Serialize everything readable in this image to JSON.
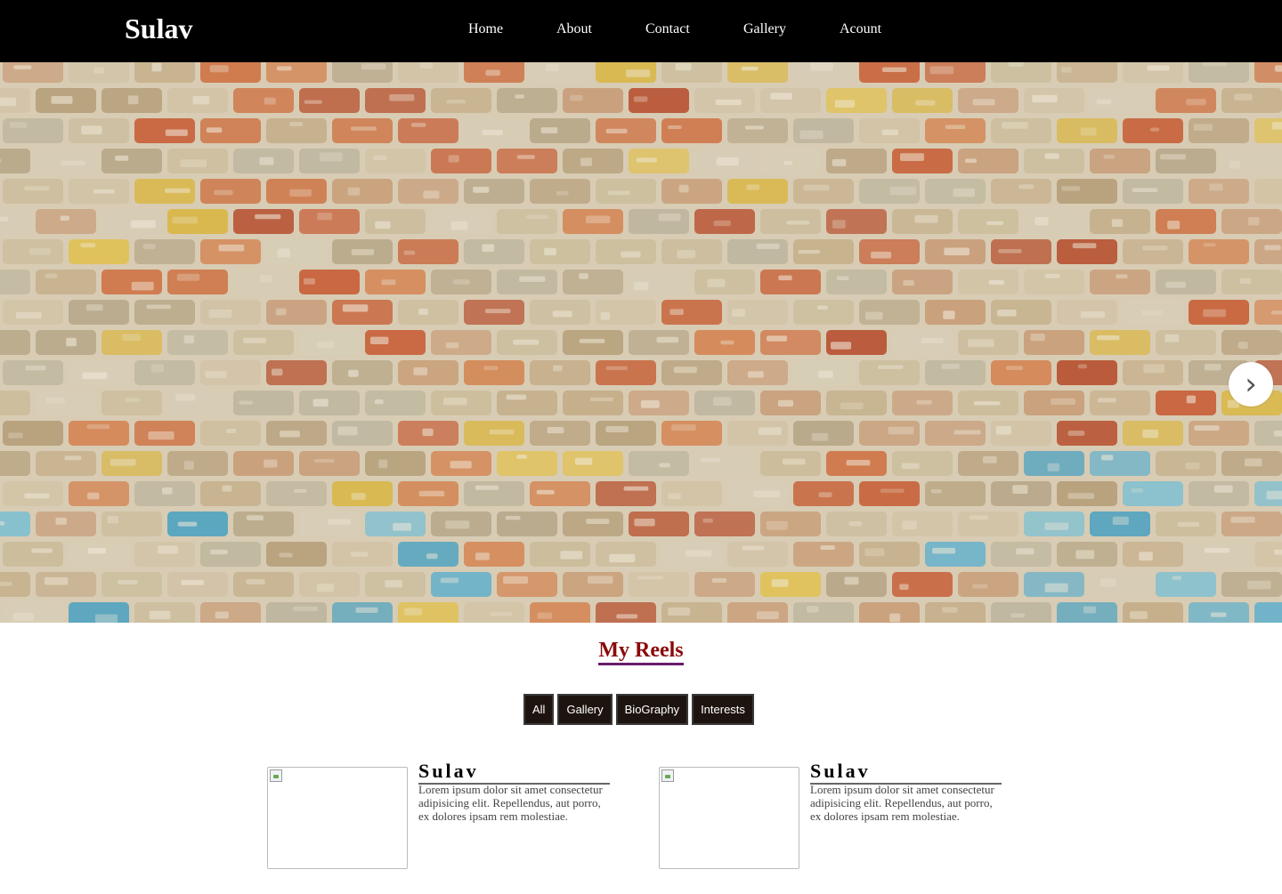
{
  "header": {
    "brand": "Sulav",
    "nav": [
      "Home",
      "About",
      "Contact",
      "Gallery",
      "Acount"
    ]
  },
  "hero": {
    "image": "brick-wall-photo",
    "next_icon": "chevron-right-icon",
    "next_glyph": "›"
  },
  "reels": {
    "title": "My Reels",
    "filters": [
      "All",
      "Gallery",
      "BioGraphy",
      "Interests"
    ],
    "cards": [
      {
        "name": "Sulav",
        "description": "Lorem ipsum dolor sit amet consectetur adipisicing elit. Repellendus, aut porro, ex dolores ipsam rem molestiae."
      },
      {
        "name": "Sulav",
        "description": "Lorem ipsum dolor sit amet consectetur adipisicing elit. Repellendus, aut porro, ex dolores ipsam rem molestiae."
      }
    ]
  },
  "colors": {
    "header_bg": "#000000",
    "title_color": "#8b0a0a",
    "title_underline": "#6a1b6a",
    "filter_bg": "#1e140f"
  }
}
